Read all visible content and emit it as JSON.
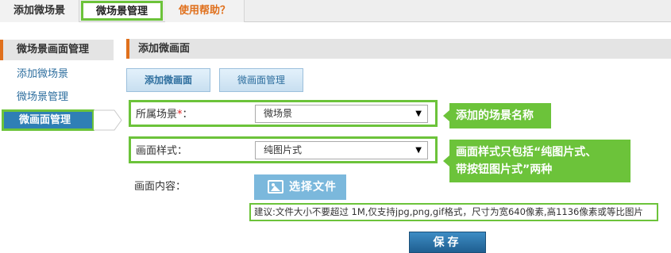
{
  "top_tabs": [
    {
      "label": "添加微场景"
    },
    {
      "label": "微场景管理"
    },
    {
      "label": "使用帮助？"
    }
  ],
  "sidebar": {
    "title": "微场景画面管理",
    "items": [
      {
        "label": "添加微场景"
      },
      {
        "label": "微场景管理"
      },
      {
        "label": "微画面管理"
      }
    ]
  },
  "main": {
    "title": "添加微画面",
    "buttons": {
      "add": "添加微画面",
      "manage": "微画面管理"
    },
    "scene_field": {
      "label": "所属场景",
      "required_mark": "*",
      "colon": "：",
      "value": "微场景"
    },
    "style_field": {
      "label": "画面样式：",
      "value": "纯图片式"
    },
    "content_field": {
      "label": "画面内容：",
      "upload_label": "选择文件",
      "hint": "建议:文件大小不要超过 1M,仅支持jpg,png,gif格式，尺寸为宽640像素,高1136像素或等比图片"
    },
    "save_label": "保存"
  },
  "callouts": {
    "scene": "添加的场景名称",
    "style_line1": "画面样式只包括“纯图片式、",
    "style_line2": "带按钮图片式”两种"
  },
  "icons": {
    "select_caret": "▼",
    "upload": "image-icon"
  },
  "colors": {
    "accent_green": "#6cc33a",
    "accent_orange": "#e0701c",
    "link_blue": "#2d6e9e",
    "active_blue": "#2f7fb5"
  }
}
